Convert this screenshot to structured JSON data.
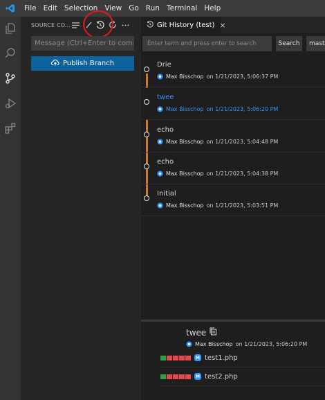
{
  "menu": {
    "items": [
      "File",
      "Edit",
      "Selection",
      "View",
      "Go",
      "Run",
      "Terminal",
      "Help"
    ]
  },
  "activity_bar": {
    "icons": [
      "explorer-icon",
      "search-icon",
      "source-control-icon",
      "run-debug-icon",
      "extensions-icon"
    ]
  },
  "sidebar": {
    "title": "SOURCE CO...",
    "tools": [
      "list-icon",
      "check-icon",
      "history-icon",
      "refresh-icon",
      "more-icon"
    ],
    "message_placeholder": "Message (Ctrl+Enter to commi...",
    "publish_label": "Publish Branch"
  },
  "tab": {
    "label": "Git History (test)",
    "close": "×"
  },
  "search": {
    "placeholder": "Enter term and press enter to search",
    "button": "Search",
    "branch": "master"
  },
  "commits": [
    {
      "message": "Drie",
      "author": "Max Bisschop",
      "date": "on 1/21/2023, 5:06:37 PM",
      "active": false
    },
    {
      "message": "twee",
      "author": "Max Bisschop",
      "date": "on 1/21/2023, 5:06:20 PM",
      "active": true
    },
    {
      "message": "echo",
      "author": "Max Bisschop",
      "date": "on 1/21/2023, 5:04:48 PM",
      "active": false
    },
    {
      "message": "echo",
      "author": "Max Bisschop",
      "date": "on 1/21/2023, 5:04:38 PM",
      "active": false
    },
    {
      "message": "Initial",
      "author": "Max Bisschop",
      "date": "on 1/21/2023, 5:03:51 PM",
      "active": false
    }
  ],
  "details": {
    "title": "twee",
    "author": "Max Bisschop",
    "date": "on 1/21/2023, 5:06:20 PM",
    "files": [
      {
        "name": "test1.php",
        "badge": "M"
      },
      {
        "name": "test2.php",
        "badge": "M"
      }
    ]
  },
  "colors": {
    "accent": "#3794ff",
    "graph": "#d07a26",
    "added": "#2ea043",
    "removed": "#e5484d",
    "annotation": "#e01c1c"
  }
}
